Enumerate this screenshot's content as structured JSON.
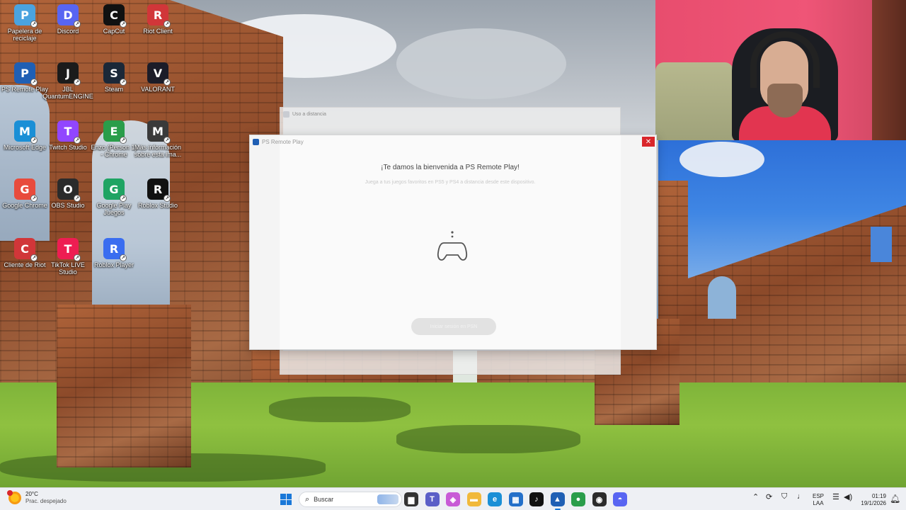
{
  "desktop": {
    "icons": [
      {
        "label": "Papelera de reciclaje",
        "icon": "recycle-bin-icon",
        "color": "#4aa3df"
      },
      {
        "label": "Discord",
        "icon": "discord-icon",
        "color": "#5865f2"
      },
      {
        "label": "CapCut",
        "icon": "capcut-icon",
        "color": "#111111"
      },
      {
        "label": "Riot Client",
        "icon": "riot-client-icon",
        "color": "#d13639"
      },
      {
        "label": "PS Remote Play",
        "icon": "ps-remote-play-icon",
        "color": "#1f5fb4"
      },
      {
        "label": "JBL QuantumENGINE",
        "icon": "jbl-quantum-icon",
        "color": "#1b1b1b"
      },
      {
        "label": "Steam",
        "icon": "steam-icon",
        "color": "#1b2838"
      },
      {
        "label": "VALORANT",
        "icon": "valorant-icon",
        "color": "#1c1c28"
      },
      {
        "label": "Microsoft Edge",
        "icon": "edge-icon",
        "color": "#1a8fd6"
      },
      {
        "label": "Twitch Studio",
        "icon": "twitch-studio-icon",
        "color": "#9146ff"
      },
      {
        "label": "Enzo (Person 1) - Chrome",
        "icon": "chrome-profile-icon",
        "color": "#2a9d4a"
      },
      {
        "label": "Más información sobre esta ima...",
        "icon": "info-camera-icon",
        "color": "#3a3a3a"
      },
      {
        "label": "Google Chrome",
        "icon": "chrome-icon",
        "color": "#e84b3c"
      },
      {
        "label": "OBS Studio",
        "icon": "obs-icon",
        "color": "#2b2b2b"
      },
      {
        "label": "Google Play Juegos",
        "icon": "google-play-games-icon",
        "color": "#1fa463"
      },
      {
        "label": "Roblox Studio",
        "icon": "roblox-studio-icon",
        "color": "#111111"
      },
      {
        "label": "Cliente de Riot",
        "icon": "riot-client-icon",
        "color": "#d13639"
      },
      {
        "label": "TikTok LIVE Studio",
        "icon": "tiktok-live-icon",
        "color": "#ee1d52"
      },
      {
        "label": "Roblox Player",
        "icon": "roblox-player-icon",
        "color": "#3a6df0"
      }
    ]
  },
  "back_window": {
    "title": "Uso a distancia"
  },
  "ps_window": {
    "title": "PS Remote Play",
    "close_glyph": "✕",
    "heading": "¡Te damos la bienvenida a PS Remote Play!",
    "subheading": "Juega a tus juegos favoritos en PS5 y PS4 a distancia desde este dispositivo.",
    "button_label": "Iniciar sesión en PSN"
  },
  "taskbar": {
    "weather_temp": "20°C",
    "weather_condition": "Prac. despejado",
    "search_placeholder": "Buscar",
    "apps": [
      {
        "name": "file-explorer-icon",
        "glyph": "▆",
        "color": "#333333"
      },
      {
        "name": "teams-icon",
        "glyph": "T",
        "color": "#5b5fc7"
      },
      {
        "name": "copilot-icon",
        "glyph": "◈",
        "color": "#c85bd6"
      },
      {
        "name": "folder-icon",
        "glyph": "▬",
        "color": "#f1b93b"
      },
      {
        "name": "edge-icon",
        "glyph": "e",
        "color": "#1a8fd6"
      },
      {
        "name": "microsoft-store-icon",
        "glyph": "▦",
        "color": "#2470c9"
      },
      {
        "name": "tiktok-icon",
        "glyph": "♪",
        "color": "#111111"
      },
      {
        "name": "ps-remote-play-icon",
        "glyph": "▲",
        "color": "#1f5fb4",
        "active": true
      },
      {
        "name": "chrome-icon",
        "glyph": "●",
        "color": "#2a9d4a"
      },
      {
        "name": "obs-icon",
        "glyph": "◉",
        "color": "#2b2b2b"
      },
      {
        "name": "discord-icon",
        "glyph": "◓",
        "color": "#5865f2"
      }
    ],
    "tray": {
      "chevron": "⌃",
      "lang_top": "ESP",
      "lang_bottom": "LAA",
      "time": "01:19",
      "date": "19/1/2026"
    }
  }
}
